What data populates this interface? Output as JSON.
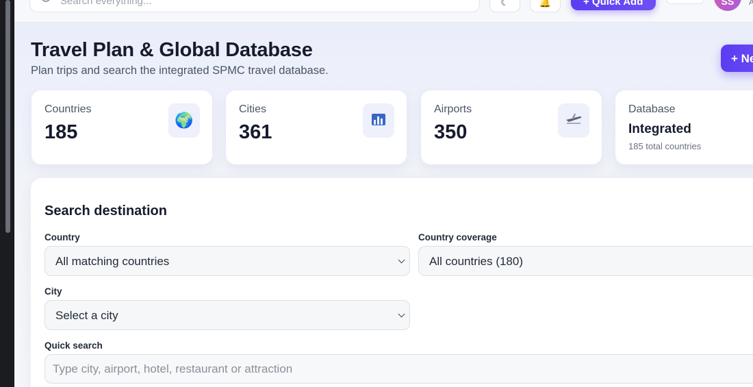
{
  "topbar": {
    "search_placeholder": "Search everything...",
    "quick_add_label": "+ Quick Add",
    "avatar_initials": "SS",
    "avatar_side_text": "A"
  },
  "header": {
    "title": "Travel Plan & Global Database",
    "subtitle": "Plan trips and search the integrated SPMC travel database.",
    "new_button_label": "+ New"
  },
  "stats": [
    {
      "label": "Countries",
      "value": "185",
      "icon": "globe-icon"
    },
    {
      "label": "Cities",
      "value": "361",
      "icon": "city-chart-icon"
    },
    {
      "label": "Airports",
      "value": "350",
      "icon": "airplane-icon"
    },
    {
      "label": "Database",
      "value": "Integrated",
      "note": "185 total countries"
    }
  ],
  "search": {
    "title": "Search destination",
    "country_label": "Country",
    "country_value": "All matching countries",
    "coverage_label": "Country coverage",
    "coverage_value": "All countries (180)",
    "city_label": "City",
    "city_value": "Select a city",
    "quick_search_label": "Quick search",
    "quick_search_placeholder": "Type city, airport, hotel, restaurant or attraction"
  },
  "colors": {
    "accent": "#5b3df0",
    "title_text": "#161b2e",
    "card_bg": "#ffffff"
  }
}
